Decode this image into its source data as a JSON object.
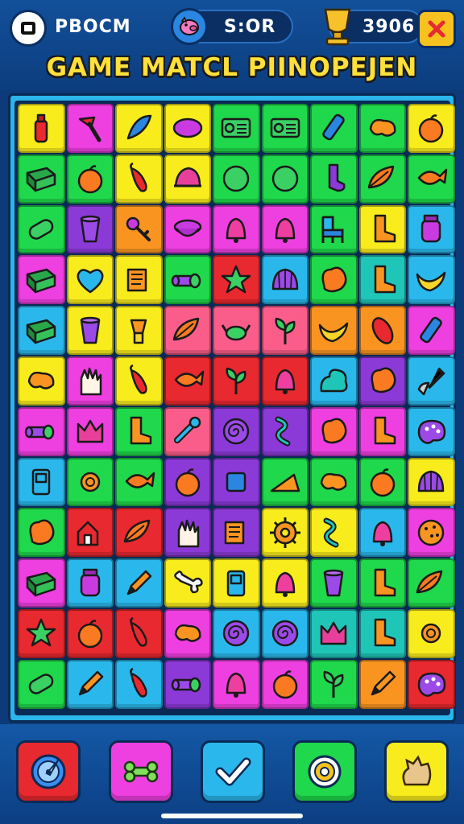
{
  "header": {
    "menu_label": "PBOCM",
    "score_label": "S:OR",
    "coins_value": "3906",
    "title": "GAME MATCL PIINOPEJEN"
  },
  "colors": {
    "yellow": "#f8ec1c",
    "magenta": "#ee3fe0",
    "green": "#1fd84b",
    "blue": "#2ab8ec",
    "orange": "#fa9421",
    "purple": "#8b3ad8",
    "red": "#e8292f",
    "pink": "#fb5d8a",
    "teal": "#1fc6b8"
  },
  "board": {
    "rows": [
      [
        {
          "c": "yellow",
          "i": "bottle"
        },
        {
          "c": "magenta",
          "i": "axe"
        },
        {
          "c": "yellow",
          "i": "feather"
        },
        {
          "c": "yellow",
          "i": "oval"
        },
        {
          "c": "green",
          "i": "radio"
        },
        {
          "c": "green",
          "i": "radio"
        },
        {
          "c": "green",
          "i": "tube"
        },
        {
          "c": "green",
          "i": "bean"
        },
        {
          "c": "yellow",
          "i": "apple"
        }
      ],
      [
        {
          "c": "green",
          "i": "book"
        },
        {
          "c": "green",
          "i": "apple"
        },
        {
          "c": "yellow",
          "i": "pepper"
        },
        {
          "c": "yellow",
          "i": "hat"
        },
        {
          "c": "green",
          "i": "ball"
        },
        {
          "c": "green",
          "i": "ball"
        },
        {
          "c": "green",
          "i": "sock"
        },
        {
          "c": "green",
          "i": "leaf"
        },
        {
          "c": "green",
          "i": "fish"
        }
      ],
      [
        {
          "c": "green",
          "i": "capsule"
        },
        {
          "c": "purple",
          "i": "cup"
        },
        {
          "c": "orange",
          "i": "key"
        },
        {
          "c": "magenta",
          "i": "bowl"
        },
        {
          "c": "magenta",
          "i": "bell"
        },
        {
          "c": "magenta",
          "i": "bell"
        },
        {
          "c": "green",
          "i": "chair"
        },
        {
          "c": "yellow",
          "i": "boot"
        },
        {
          "c": "blue",
          "i": "jar"
        }
      ],
      [
        {
          "c": "magenta",
          "i": "book"
        },
        {
          "c": "yellow",
          "i": "heart"
        },
        {
          "c": "yellow",
          "i": "scroll"
        },
        {
          "c": "green",
          "i": "roll"
        },
        {
          "c": "red",
          "i": "star"
        },
        {
          "c": "blue",
          "i": "shell"
        },
        {
          "c": "green",
          "i": "blob"
        },
        {
          "c": "teal",
          "i": "boot"
        },
        {
          "c": "blue",
          "i": "banana"
        }
      ],
      [
        {
          "c": "blue",
          "i": "book"
        },
        {
          "c": "yellow",
          "i": "cup"
        },
        {
          "c": "yellow",
          "i": "lamp"
        },
        {
          "c": "pink",
          "i": "leaf"
        },
        {
          "c": "pink",
          "i": "crab"
        },
        {
          "c": "pink",
          "i": "sprout"
        },
        {
          "c": "orange",
          "i": "banana"
        },
        {
          "c": "orange",
          "i": "corn"
        },
        {
          "c": "magenta",
          "i": "tube"
        }
      ],
      [
        {
          "c": "yellow",
          "i": "bean"
        },
        {
          "c": "magenta",
          "i": "hand"
        },
        {
          "c": "yellow",
          "i": "pepper"
        },
        {
          "c": "red",
          "i": "fish"
        },
        {
          "c": "red",
          "i": "sprout"
        },
        {
          "c": "red",
          "i": "bell"
        },
        {
          "c": "blue",
          "i": "bush"
        },
        {
          "c": "purple",
          "i": "blob"
        },
        {
          "c": "blue",
          "i": "shovel"
        }
      ],
      [
        {
          "c": "magenta",
          "i": "roll"
        },
        {
          "c": "magenta",
          "i": "crown"
        },
        {
          "c": "green",
          "i": "boot"
        },
        {
          "c": "pink",
          "i": "wrench"
        },
        {
          "c": "purple",
          "i": "spiral"
        },
        {
          "c": "purple",
          "i": "wave"
        },
        {
          "c": "magenta",
          "i": "blob"
        },
        {
          "c": "magenta",
          "i": "boot"
        },
        {
          "c": "blue",
          "i": "palette"
        }
      ],
      [
        {
          "c": "blue",
          "i": "phone"
        },
        {
          "c": "green",
          "i": "coin"
        },
        {
          "c": "green",
          "i": "fish"
        },
        {
          "c": "purple",
          "i": "apple"
        },
        {
          "c": "purple",
          "i": "cube"
        },
        {
          "c": "green",
          "i": "cheese"
        },
        {
          "c": "green",
          "i": "bean"
        },
        {
          "c": "green",
          "i": "apple"
        },
        {
          "c": "yellow",
          "i": "shell"
        }
      ],
      [
        {
          "c": "green",
          "i": "blob"
        },
        {
          "c": "red",
          "i": "house"
        },
        {
          "c": "red",
          "i": "leaf"
        },
        {
          "c": "purple",
          "i": "hand"
        },
        {
          "c": "purple",
          "i": "scroll"
        },
        {
          "c": "yellow",
          "i": "gear"
        },
        {
          "c": "yellow",
          "i": "wave"
        },
        {
          "c": "blue",
          "i": "bell"
        },
        {
          "c": "magenta",
          "i": "cookie"
        }
      ],
      [
        {
          "c": "magenta",
          "i": "book"
        },
        {
          "c": "blue",
          "i": "jar"
        },
        {
          "c": "blue",
          "i": "pencil"
        },
        {
          "c": "yellow",
          "i": "bone"
        },
        {
          "c": "yellow",
          "i": "phone"
        },
        {
          "c": "yellow",
          "i": "bell"
        },
        {
          "c": "green",
          "i": "cup"
        },
        {
          "c": "green",
          "i": "boot"
        },
        {
          "c": "green",
          "i": "leaf"
        }
      ],
      [
        {
          "c": "red",
          "i": "star"
        },
        {
          "c": "red",
          "i": "apple"
        },
        {
          "c": "red",
          "i": "pepper"
        },
        {
          "c": "magenta",
          "i": "bean"
        },
        {
          "c": "blue",
          "i": "spiral"
        },
        {
          "c": "blue",
          "i": "spiral"
        },
        {
          "c": "teal",
          "i": "crown"
        },
        {
          "c": "teal",
          "i": "boot"
        },
        {
          "c": "yellow",
          "i": "coin"
        }
      ],
      [
        {
          "c": "green",
          "i": "capsule"
        },
        {
          "c": "blue",
          "i": "pencil"
        },
        {
          "c": "blue",
          "i": "pepper"
        },
        {
          "c": "purple",
          "i": "roll"
        },
        {
          "c": "magenta",
          "i": "bell"
        },
        {
          "c": "magenta",
          "i": "apple"
        },
        {
          "c": "green",
          "i": "sprout"
        },
        {
          "c": "orange",
          "i": "pencil"
        },
        {
          "c": "red",
          "i": "palette"
        }
      ]
    ]
  },
  "boosters": [
    {
      "name": "compass",
      "color": "#e8292f"
    },
    {
      "name": "bone",
      "color": "#ee3fe0"
    },
    {
      "name": "check",
      "color": "#2ab8ec"
    },
    {
      "name": "donut",
      "color": "#1fd84b"
    },
    {
      "name": "bag",
      "color": "#f8ec1c"
    }
  ]
}
